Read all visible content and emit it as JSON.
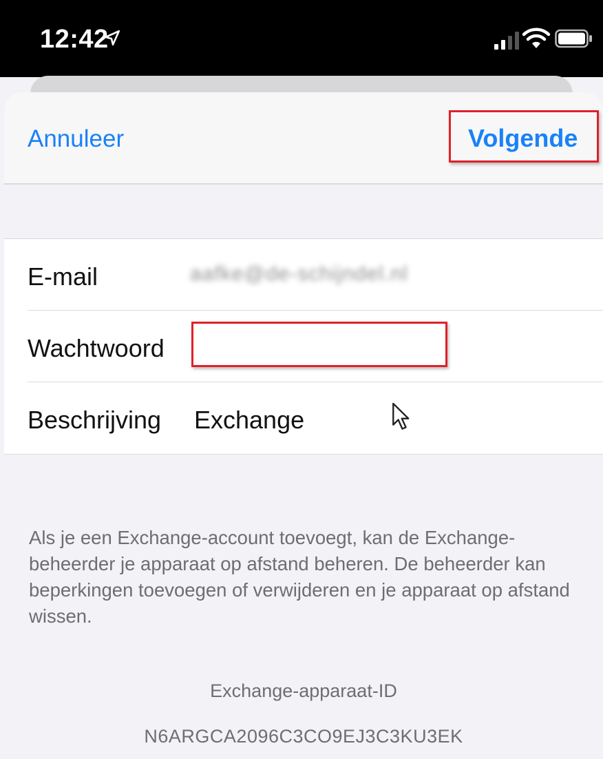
{
  "status_bar": {
    "time": "12:42",
    "icons": [
      "location-arrow-icon",
      "signal-icon",
      "wifi-icon",
      "battery-icon"
    ]
  },
  "nav": {
    "cancel_label": "Annuleer",
    "next_label": "Volgende"
  },
  "form": {
    "email": {
      "label": "E-mail",
      "value": "aafke@de-schijndel.nl"
    },
    "password": {
      "label": "Wachtwoord",
      "value": ""
    },
    "description": {
      "label": "Beschrijving",
      "value": "Exchange"
    }
  },
  "footer": {
    "info": "Als je een Exchange-account toevoegt, kan de Exchange-beheerder je apparaat op afstand beheren. De beheerder kan beperkingen toevoegen of verwijderen en je apparaat op afstand wissen.",
    "device_id_label": "Exchange-apparaat-ID",
    "device_id_value": "N6ARGCA2096C3CO9EJ3C3KU3EK"
  },
  "colors": {
    "accent": "#1982f7",
    "highlight": "#e0202a",
    "background": "#f2f2f7",
    "secondary_text": "#6d6d72"
  }
}
